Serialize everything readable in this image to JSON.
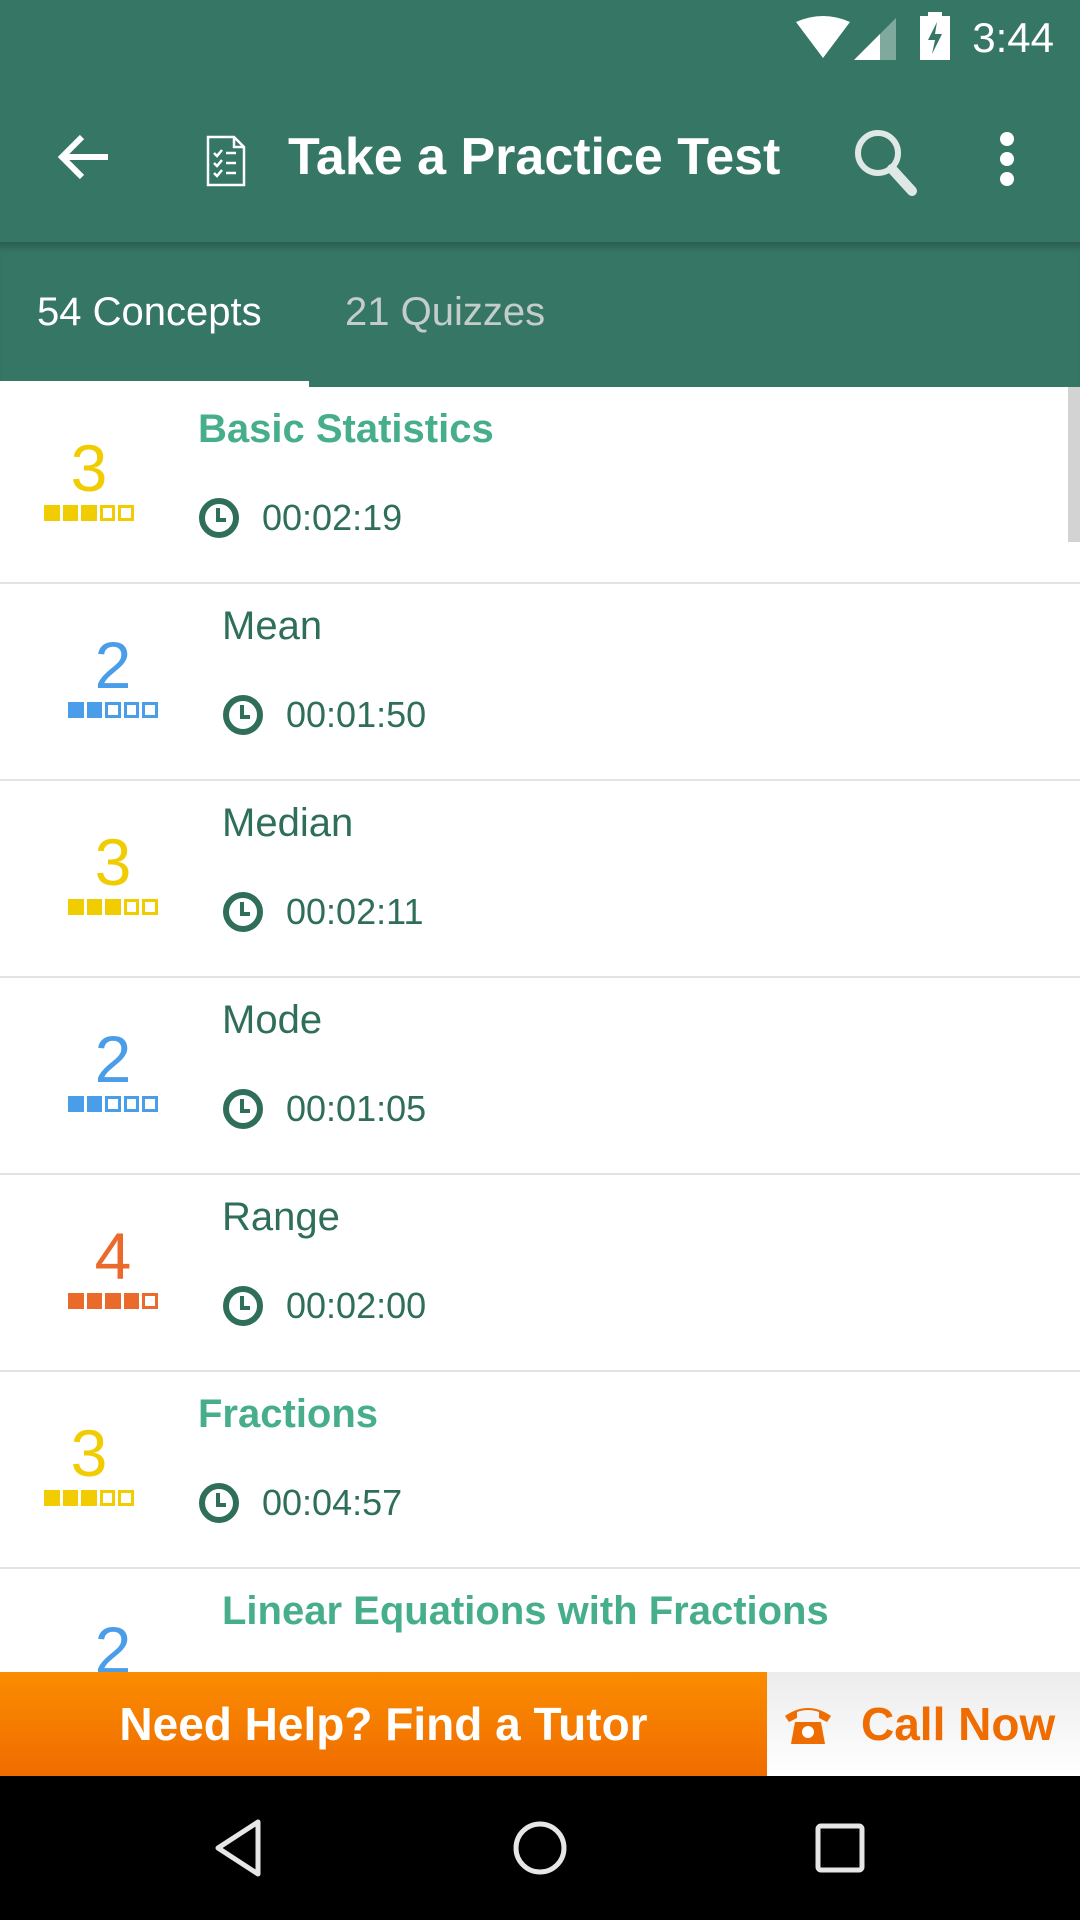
{
  "status_bar": {
    "time": "3:44",
    "icons": [
      "wifi-icon",
      "signal-icon",
      "battery-charging-icon"
    ]
  },
  "toolbar": {
    "title": "Take a Practice Test",
    "back_icon": "arrow-back-icon",
    "title_icon": "checklist-document-icon",
    "search_icon": "search-icon",
    "more_icon": "more-vert-icon"
  },
  "tabs": [
    {
      "label": "54 Concepts",
      "active": true
    },
    {
      "label": "21 Quizzes",
      "active": false
    }
  ],
  "colors": {
    "primary": "#367664",
    "topic_text": "#46ae8a",
    "concept_text": "#2f6e5a",
    "level_2": "#4a9de8",
    "level_3": "#f0cc00",
    "level_4": "#e96a2a",
    "banner_orange": "#f57c00"
  },
  "list": {
    "items": [
      {
        "name": "Basic Statistics",
        "kind": "topic",
        "level": 3,
        "max_level": 5,
        "time": "00:02:19"
      },
      {
        "name": "Mean",
        "kind": "concept",
        "level": 2,
        "max_level": 5,
        "time": "00:01:50"
      },
      {
        "name": "Median",
        "kind": "concept",
        "level": 3,
        "max_level": 5,
        "time": "00:02:11"
      },
      {
        "name": "Mode",
        "kind": "concept",
        "level": 2,
        "max_level": 5,
        "time": "00:01:05"
      },
      {
        "name": "Range",
        "kind": "concept",
        "level": 4,
        "max_level": 5,
        "time": "00:02:00"
      },
      {
        "name": "Fractions",
        "kind": "topic",
        "level": 3,
        "max_level": 5,
        "time": "00:04:57"
      },
      {
        "name": "Linear Equations with Fractions",
        "kind": "concept-topic",
        "level": 2,
        "max_level": 5,
        "time": ""
      }
    ]
  },
  "banner": {
    "tutor_label": "Need Help? Find a Tutor",
    "call_label": "Call Now",
    "call_icon": "phone-icon"
  },
  "nav_bar": {
    "buttons": [
      "back-nav-icon",
      "home-nav-icon",
      "recents-nav-icon"
    ]
  }
}
